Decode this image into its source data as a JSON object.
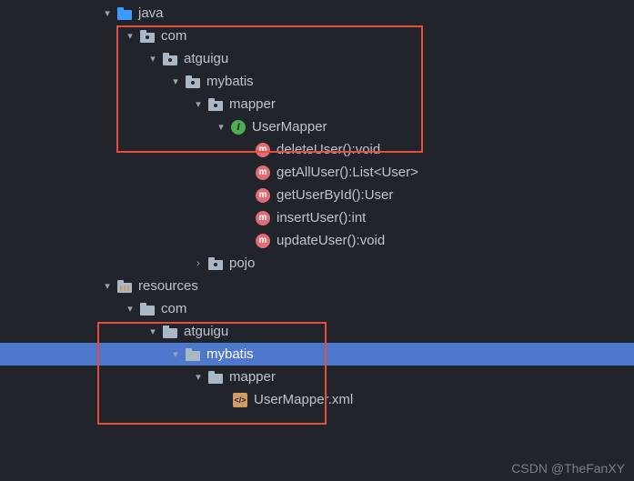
{
  "tree": {
    "java": "java",
    "com": "com",
    "atguigu": "atguigu",
    "mybatis": "mybatis",
    "mapper": "mapper",
    "userMapper": "UserMapper",
    "methods": {
      "deleteUser": "deleteUser():void",
      "getAllUser": "getAllUser():List<User>",
      "getUserById": "getUserById():User",
      "insertUser": "insertUser():int",
      "updateUser": "updateUser():void"
    },
    "pojo": "pojo",
    "resources": "resources",
    "res_com": "com",
    "res_atguigu": "atguigu",
    "res_mybatis": "mybatis",
    "res_mapper": "mapper",
    "userMapperXml": "UserMapper.xml"
  },
  "watermark": "CSDN @TheFanXY"
}
